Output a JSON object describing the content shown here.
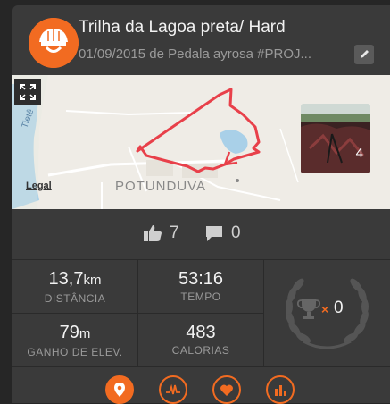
{
  "activity": {
    "title": "Trilha da Lagoa preta/ Hard",
    "subtitle": "01/09/2015 de Pedala ayrosa  #PROJ...",
    "avatar_text": "Pedala Ayrosa"
  },
  "map": {
    "place_label": "POTUNDUVA",
    "legal_label": "Legal",
    "photo_count": "4"
  },
  "social": {
    "likes": "7",
    "comments": "0"
  },
  "stats": {
    "distance": {
      "value": "13,7",
      "unit": "km",
      "label": "DISTÂNCIA"
    },
    "time": {
      "value": "53:16",
      "unit": "",
      "label": "TEMPO"
    },
    "elevation": {
      "value": "79",
      "unit": "m",
      "label": "GANHO DE ELEV."
    },
    "calories": {
      "value": "483",
      "unit": "",
      "label": "CALORIAS"
    },
    "trophies": {
      "count": "0"
    }
  },
  "colors": {
    "accent": "#f26b21",
    "card": "#3a3a3a",
    "route": "#e8404a"
  },
  "nav": {
    "items": [
      "location-pin-icon",
      "heart-rate-chart-icon",
      "heart-icon",
      "bar-chart-icon"
    ]
  }
}
